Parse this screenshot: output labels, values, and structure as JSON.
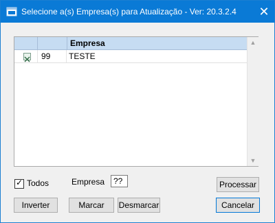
{
  "window": {
    "title": "Selecione a(s) Empresa(s) para Atualização - Ver: 20.3.2.4",
    "close_glyph": "✕",
    "icon": "app-window-icon"
  },
  "grid": {
    "columns": [
      "",
      "",
      "Empresa"
    ],
    "rows": [
      {
        "selected": true,
        "code": "99",
        "name": "TESTE"
      }
    ],
    "scroll_up_glyph": "▲",
    "scroll_down_glyph": "▼"
  },
  "controls": {
    "todos_label": "Todos",
    "todos_checked": true,
    "empresa_label": "Empresa",
    "empresa_value": "??"
  },
  "buttons": {
    "processar": "Processar",
    "inverter": "Inverter",
    "marcar": "Marcar",
    "desmarcar": "Desmarcar",
    "cancelar": "Cancelar"
  }
}
